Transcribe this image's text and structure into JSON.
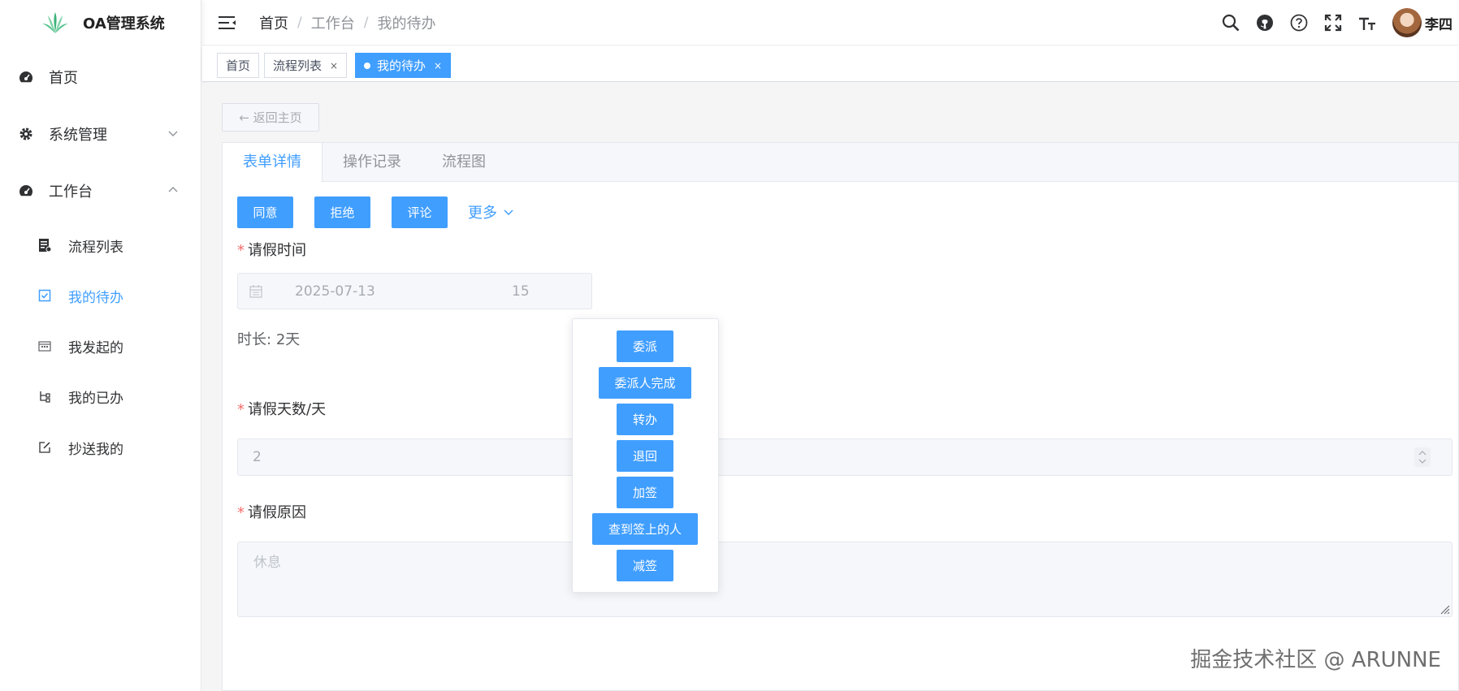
{
  "app": {
    "title": "OA管理系统",
    "username": "李四"
  },
  "sidebar": {
    "items": [
      {
        "label": "首页"
      },
      {
        "label": "系统管理"
      },
      {
        "label": "工作台"
      }
    ],
    "sub_items": [
      {
        "label": "流程列表"
      },
      {
        "label": "我的待办"
      },
      {
        "label": "我发起的"
      },
      {
        "label": "我的已办"
      },
      {
        "label": "抄送我的"
      }
    ]
  },
  "header": {
    "breadcrumb": [
      "首页",
      "工作台",
      "我的待办"
    ],
    "separator": "/"
  },
  "tags": [
    {
      "label": "首页"
    },
    {
      "label": "流程列表",
      "close": "×"
    },
    {
      "label": "我的待办",
      "close": "×"
    }
  ],
  "main": {
    "back_label": "← 返回主页",
    "tabs": [
      "表单详情",
      "操作记录",
      "流程图"
    ],
    "actions": {
      "agree": "同意",
      "reject": "拒绝",
      "comment": "评论",
      "more": "更多"
    },
    "more_menu": [
      "委派",
      "委派人完成",
      "转办",
      "退回",
      "加签",
      "查到签上的人",
      "减签"
    ],
    "form": {
      "leave_time_label": "请假时间",
      "date_start": "2025-07-13",
      "date_end_partial": "15",
      "duration_label": "时长:",
      "duration_value": "2天",
      "days_label": "请假天数/天",
      "days_value": "2",
      "reason_label": "请假原因",
      "reason_placeholder": "休息",
      "required_mark": "*"
    }
  },
  "watermark": "掘金技术社区 @ ARUNNE",
  "colors": {
    "primary": "#409eff",
    "required": "#f56c6c"
  }
}
